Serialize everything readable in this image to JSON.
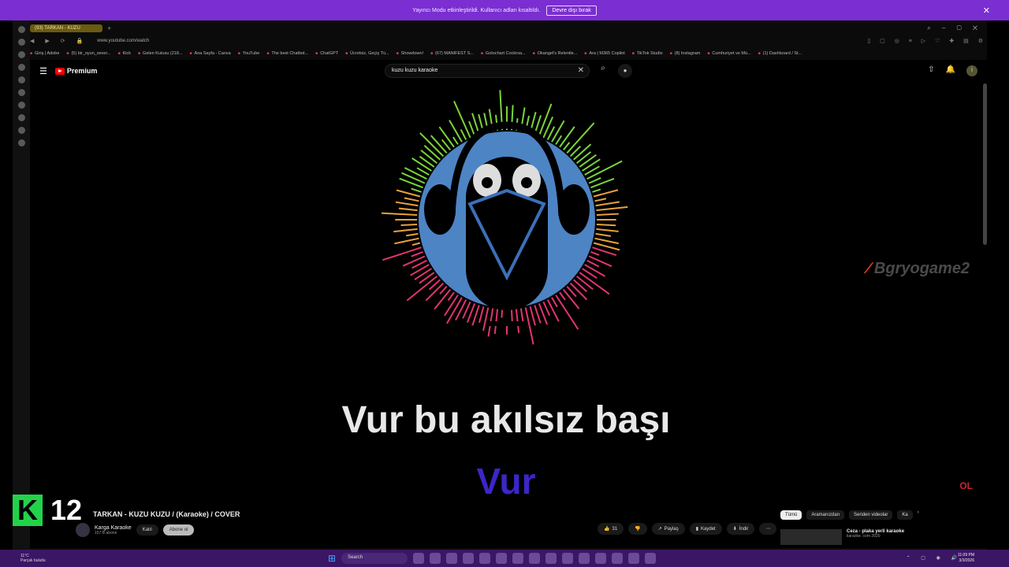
{
  "banner": {
    "text": "Yayıncı Modu etkinleştirildi. Kullanıcı adları kısaltıldı.",
    "button": "Devre dışı bırak"
  },
  "browser": {
    "active_tab": "(93) TARKAN - KUZU",
    "url": "www.youtube.com/watch",
    "bookmarks": [
      "Giriş | Adobe",
      "(5) bir_oyun_sever...",
      "Kick",
      "Gelen Kutusu (218...",
      "Ana Sayfa - Canva",
      "YouTube",
      "The best Chatbot...",
      "ChatGPT",
      "Ücretsiz, Geçiş Tü...",
      "Showdown!",
      "(67) MANIFEST S...",
      "Gotochart Cockroa...",
      "Okangel's Relentle...",
      "Ara | M365 Copilot",
      "TikTok Studio",
      "(8) Instagram",
      "Cumhuriyet ve Mü...",
      "(1) Dashboard / St..."
    ]
  },
  "youtube": {
    "brand": "Premium",
    "search_value": "kuzu kuzu karaoke",
    "notif_badge": "9+",
    "avatar": "İ"
  },
  "video": {
    "watermark_red": "∕",
    "watermark_text": "Bgryogame2",
    "lyric_line": "Vur bu akılsız başı",
    "lyric_active": "Vur",
    "corner_logo": "OL"
  },
  "below": {
    "title": "TARKAN - KUZU KUZU / (Karaoke) / COVER",
    "channel": "Karga Karaoke",
    "subs": "157 B abone",
    "join": "Katıl",
    "subscribe": "Abone ol",
    "likes": "31",
    "share": "Paylaş",
    "save": "Kaydet",
    "download": "İndir",
    "chips": [
      "Tümü",
      "Aramanızdan",
      "Seriden videolar",
      "Ka"
    ],
    "rec_title": "Ceza - plaka yerli karaoke",
    "rec_sub": "karaoke. com 2020"
  },
  "overlay": {
    "k": "K",
    "num": "12"
  },
  "taskbar": {
    "temp": "11°C",
    "weather": "Parçalı bulutlu",
    "search": "Search",
    "time": "11:09 PM",
    "date": "3/3/2026"
  }
}
